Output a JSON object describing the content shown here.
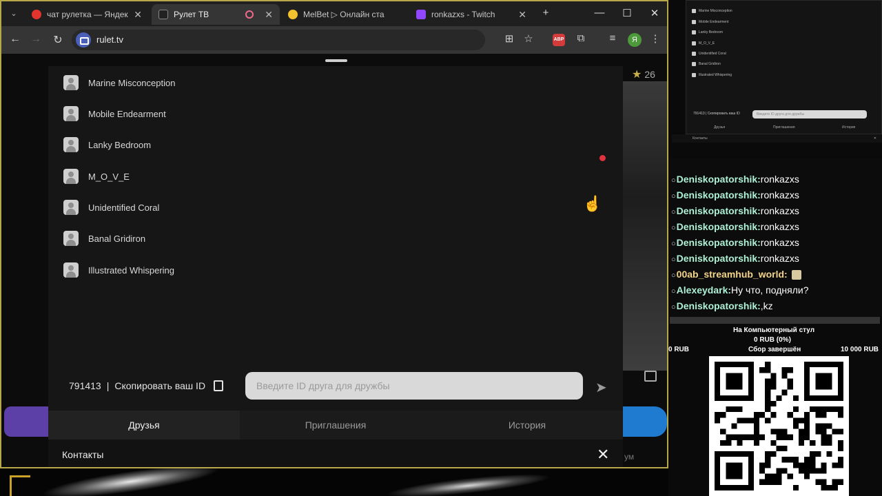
{
  "browser": {
    "tabs": [
      {
        "title": "чат рулетка — Яндекс: на",
        "favicon_color": "#e4342e",
        "active": false
      },
      {
        "title": "Рулет ТВ",
        "favicon_color": "#222222",
        "active": true
      },
      {
        "title": "MelBet ▷ Онлайн ставки",
        "favicon_color": "#f2c12e",
        "active": false
      },
      {
        "title": "ronkazxs - Twitch",
        "favicon_color": "#9146ff",
        "active": false
      }
    ],
    "new_tab_icon": "plus-icon",
    "url": "rulet.tv",
    "profile_initial": "Я",
    "abp_label": "ABP"
  },
  "contacts": {
    "items": [
      {
        "name": "Marine Misconception",
        "online": false
      },
      {
        "name": "Mobile Endearment",
        "online": false
      },
      {
        "name": "Lanky Bedroom",
        "online": true
      },
      {
        "name": "M_O_V_E",
        "online": false
      },
      {
        "name": "Unidentified Coral",
        "online": false
      },
      {
        "name": "Banal Gridiron",
        "online": false
      },
      {
        "name": "Illustrated Whispering",
        "online": false
      }
    ],
    "my_id": "791413",
    "copy_label": "Скопировать ваш ID",
    "separator": "|",
    "friend_input_placeholder": "Введите ID друга для дружбы",
    "tabs": [
      "Друзья",
      "Приглашения",
      "История"
    ],
    "active_tab": "Друзья",
    "footer_title": "Контакты",
    "star_count": "26",
    "footer_right_text": "ум"
  },
  "mini_panel": {
    "items": [
      "Marine Misconception",
      "Mobile Endearment",
      "Lanky Bedroom",
      "M_O_V_E",
      "Unidentified Coral",
      "Banal Gridiron",
      "Illustrated Whispering"
    ],
    "id_text": "791413 | Скопировать ваш ID",
    "input_placeholder": "Введите ID друга для дружбы",
    "tabs": [
      "Друзья",
      "Приглашения",
      "История"
    ],
    "footer_title": "Контакты"
  },
  "chat": {
    "messages": [
      {
        "nick": "Deniskopatorshik:",
        "msg": "ronkazxs"
      },
      {
        "nick": "Deniskopatorshik:",
        "msg": "ronkazxs"
      },
      {
        "nick": "Deniskopatorshik:",
        "msg": "ronkazxs"
      },
      {
        "nick": "Deniskopatorshik:",
        "msg": "ronkazxs"
      },
      {
        "nick": "Deniskopatorshik:",
        "msg": "ronkazxs"
      },
      {
        "nick": "Deniskopatorshik:",
        "msg": "ronkazxs"
      },
      {
        "nick": "00ab_streamhub_world:",
        "msg": " "
      },
      {
        "nick": "Alexeydark:",
        "msg": "Ну что, подняли?"
      },
      {
        "nick": "Deniskopatorshik:",
        "msg": ",kz"
      }
    ]
  },
  "donation": {
    "title": "На Компьютерный стул",
    "amount": "0 RUB (0%)",
    "left": "0 RUB",
    "status": "Сбор завершён",
    "right": "10 000 RUB",
    "progress": 0
  },
  "colors": {
    "window_border": "#b9a84a",
    "chat_nick": "#aef2d7",
    "online_dot": "#e0333f"
  }
}
